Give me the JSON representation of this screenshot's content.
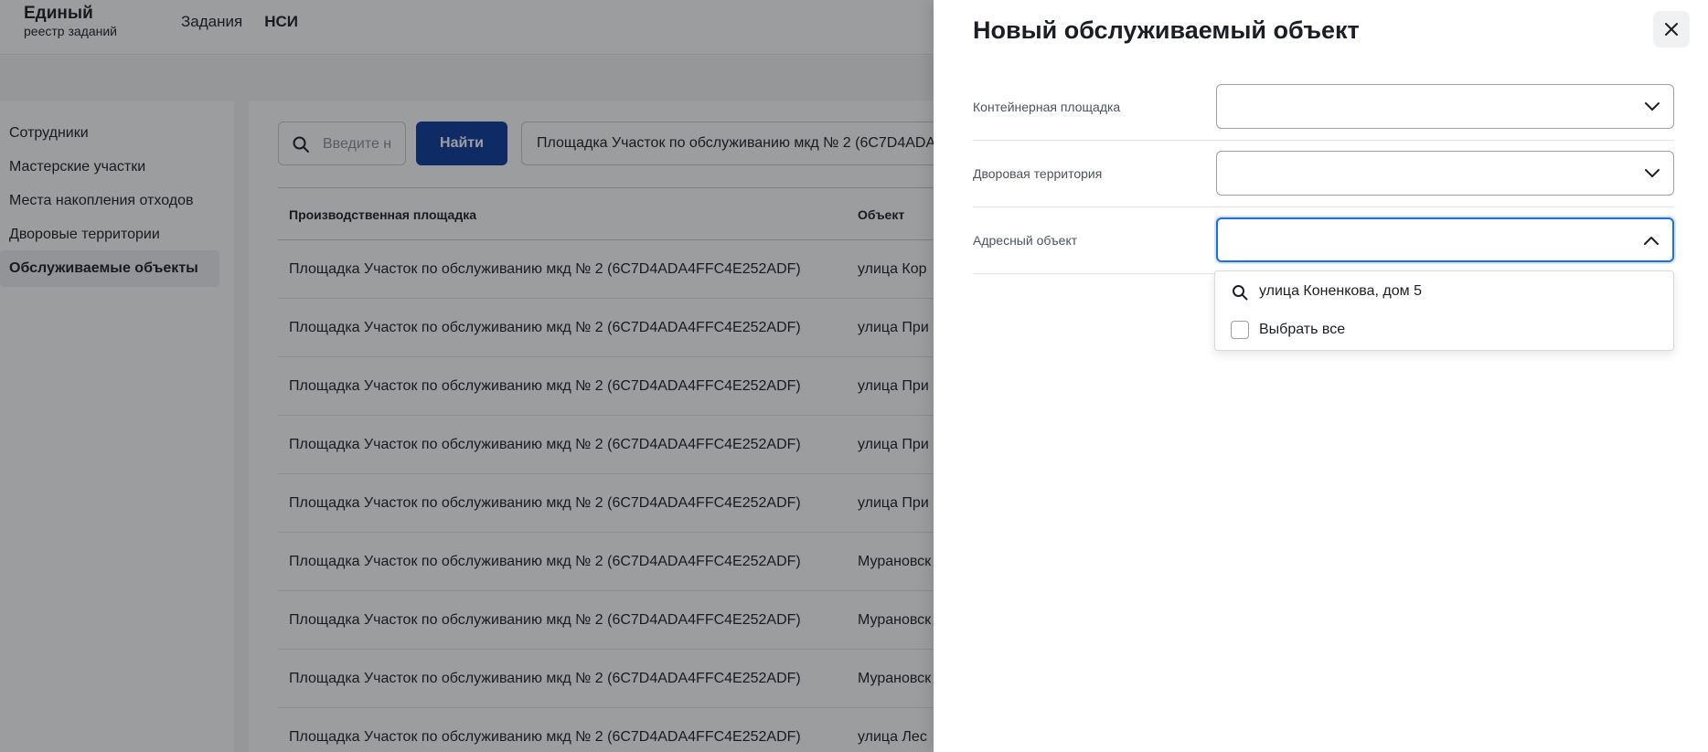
{
  "app": {
    "logo_title": "Единый",
    "logo_subtitle": "реестр заданий",
    "nav": [
      {
        "label": "Задания",
        "active": false
      },
      {
        "label": "НСИ",
        "active": true
      }
    ]
  },
  "sidebar": {
    "items": [
      {
        "label": "Сотрудники",
        "active": false
      },
      {
        "label": "Мастерские участки",
        "active": false
      },
      {
        "label": "Места накопления отходов",
        "active": false
      },
      {
        "label": "Дворовые территории",
        "active": false
      },
      {
        "label": "Обслуживаемые объекты",
        "active": true
      }
    ]
  },
  "toolbar": {
    "search_placeholder": "Введите н",
    "find_label": "Найти",
    "filter_chip": "Площадка Участок по обслуживанию мкд № 2 (6C7D4ADA4FFC4E252ADF)"
  },
  "table": {
    "columns": [
      "Производственная площадка",
      "Объект"
    ],
    "rows": [
      [
        "Площадка Участок по обслуживанию мкд № 2 (6C7D4ADA4FFC4E252ADF)",
        "улица Кор"
      ],
      [
        "Площадка Участок по обслуживанию мкд № 2 (6C7D4ADA4FFC4E252ADF)",
        "улица При"
      ],
      [
        "Площадка Участок по обслуживанию мкд № 2 (6C7D4ADA4FFC4E252ADF)",
        "улица При"
      ],
      [
        "Площадка Участок по обслуживанию мкд № 2 (6C7D4ADA4FFC4E252ADF)",
        "улица При"
      ],
      [
        "Площадка Участок по обслуживанию мкд № 2 (6C7D4ADA4FFC4E252ADF)",
        "улица При"
      ],
      [
        "Площадка Участок по обслуживанию мкд № 2 (6C7D4ADA4FFC4E252ADF)",
        "Мурановск"
      ],
      [
        "Площадка Участок по обслуживанию мкд № 2 (6C7D4ADA4FFC4E252ADF)",
        "Мурановск"
      ],
      [
        "Площадка Участок по обслуживанию мкд № 2 (6C7D4ADA4FFC4E252ADF)",
        "Мурановск"
      ],
      [
        "Площадка Участок по обслуживанию мкд № 2 (6C7D4ADA4FFC4E252ADF)",
        "улица Лес"
      ]
    ]
  },
  "drawer": {
    "title": "Новый обслуживаемый объект",
    "fields": [
      {
        "label": "Контейнерная площадка",
        "value": "",
        "open": false
      },
      {
        "label": "Дворовая территория",
        "value": "",
        "open": false
      },
      {
        "label": "Адресный объект",
        "value": "",
        "open": true
      }
    ],
    "dropdown": {
      "search_value": "улица Коненкова, дом 5",
      "select_all_label": "Выбрать все",
      "select_all_checked": false
    }
  },
  "colors": {
    "primary_button": "#0b3c9c",
    "focus_border": "#1a6ee6",
    "overlay": "rgba(20,22,26,0.42)"
  },
  "icons": {
    "search": "search-icon",
    "close": "close-icon",
    "chevron_down": "chevron-down-icon",
    "chevron_up": "chevron-up-icon"
  }
}
